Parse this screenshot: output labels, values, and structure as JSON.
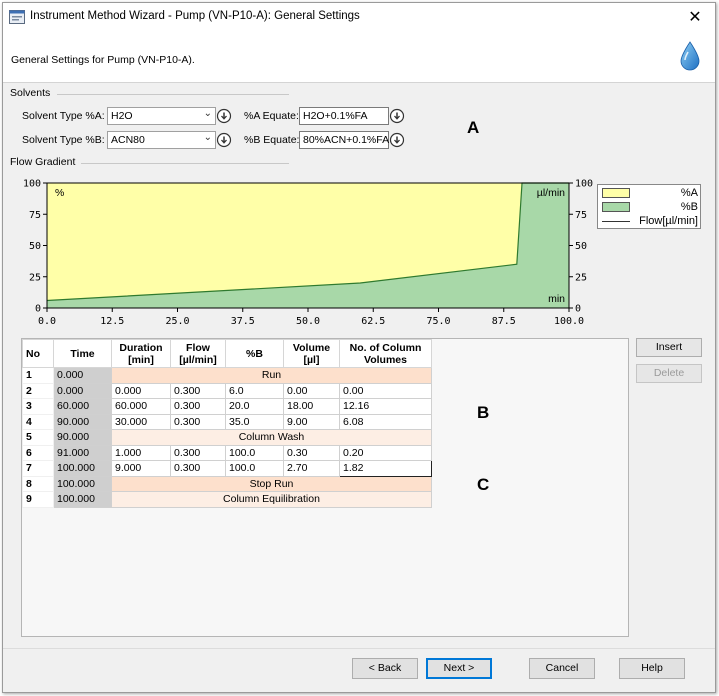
{
  "window": {
    "title": "Instrument Method Wizard - Pump (VN-P10-A): General Settings",
    "header_text": "General Settings for Pump (VN-P10-A)."
  },
  "solvents": {
    "group_label": "Solvents",
    "type_a_label": "Solvent Type %A:",
    "type_a_value": "H2O",
    "type_b_label": "Solvent Type %B:",
    "type_b_value": "ACN80",
    "equate_a_label": "%A Equate:",
    "equate_a_value": "H2O+0.1%FA",
    "equate_b_label": "%B Equate:",
    "equate_b_value": "80%ACN+0.1%FA"
  },
  "flow_gradient": {
    "group_label": "Flow Gradient"
  },
  "annotations": {
    "a": "A",
    "b": "B",
    "c": "C"
  },
  "chart_data": {
    "type": "area",
    "title": "",
    "left_axis_unit": "%",
    "right_axis_unit": "µl/min",
    "x_axis_unit": "min",
    "xlim": [
      0,
      100
    ],
    "ylim": [
      0,
      100
    ],
    "x_ticks": [
      "0.0",
      "12.5",
      "25.0",
      "37.5",
      "50.0",
      "62.5",
      "75.0",
      "87.5",
      "100.0"
    ],
    "y_ticks": [
      "0",
      "25",
      "50",
      "75",
      "100"
    ],
    "series": [
      {
        "name": "%A",
        "color": "#ffffa8"
      },
      {
        "name": "%B",
        "color": "#a8d8a8",
        "x": [
          0,
          60,
          90,
          91,
          100
        ],
        "y": [
          6,
          20,
          35,
          100,
          100
        ]
      },
      {
        "name": "Flow[µl/min]",
        "color": "#333333"
      }
    ],
    "legend_position": "right"
  },
  "table": {
    "headers": [
      "No",
      "Time",
      "Duration [min]",
      "Flow [µl/min]",
      "%B",
      "Volume [µl]",
      "No. of Column Volumes"
    ],
    "rows": [
      {
        "no": "1",
        "time": "0.000",
        "span": "Run"
      },
      {
        "no": "2",
        "time": "0.000",
        "duration": "0.000",
        "flow": "0.300",
        "b": "6.0",
        "volume": "0.00",
        "col_vol": "0.00"
      },
      {
        "no": "3",
        "time": "60.000",
        "duration": "60.000",
        "flow": "0.300",
        "b": "20.0",
        "volume": "18.00",
        "col_vol": "12.16"
      },
      {
        "no": "4",
        "time": "90.000",
        "duration": "30.000",
        "flow": "0.300",
        "b": "35.0",
        "volume": "9.00",
        "col_vol": "6.08"
      },
      {
        "no": "5",
        "time": "90.000",
        "span": "Column Wash"
      },
      {
        "no": "6",
        "time": "91.000",
        "duration": "1.000",
        "flow": "0.300",
        "b": "100.0",
        "volume": "0.30",
        "col_vol": "0.20"
      },
      {
        "no": "7",
        "time": "100.000",
        "duration": "9.000",
        "flow": "0.300",
        "b": "100.0",
        "volume": "2.70",
        "col_vol": "1.82"
      },
      {
        "no": "8",
        "time": "100.000",
        "span": "Stop Run"
      },
      {
        "no": "9",
        "time": "100.000",
        "span": "Column Equilibration"
      }
    ]
  },
  "side_buttons": {
    "insert": "Insert",
    "delete": "Delete"
  },
  "footer": {
    "back": "< Back",
    "next": "Next >",
    "cancel": "Cancel",
    "help": "Help"
  }
}
